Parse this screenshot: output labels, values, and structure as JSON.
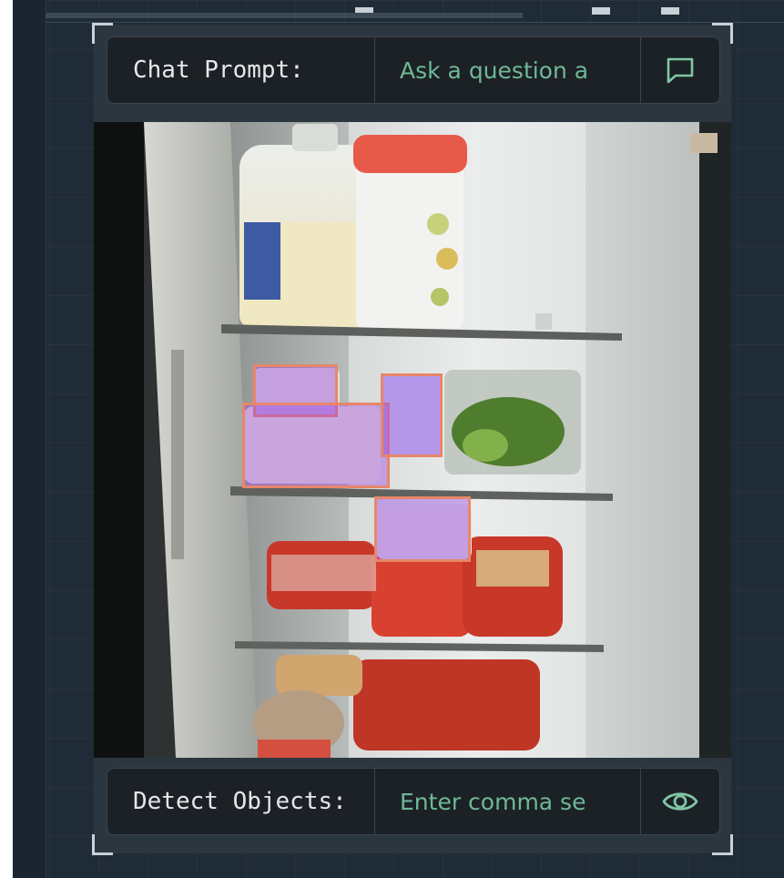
{
  "chat": {
    "label": "Chat Prompt:",
    "placeholder": "Ask a question a",
    "button_icon": "chat-bubble-icon"
  },
  "detect": {
    "label": "Detect Objects:",
    "placeholder": "Enter comma se",
    "button_icon": "eye-icon"
  },
  "camera": {
    "scene": "open refrigerator interior",
    "detection_color": "#e8866a",
    "detection_fill": "#9646e6",
    "detections": [
      {
        "name": "container"
      },
      {
        "name": "container"
      },
      {
        "name": "container"
      },
      {
        "name": "container"
      }
    ]
  },
  "colors": {
    "accent": "#7fc7a4",
    "panel": "#2c363f",
    "bar": "#1c2126"
  }
}
